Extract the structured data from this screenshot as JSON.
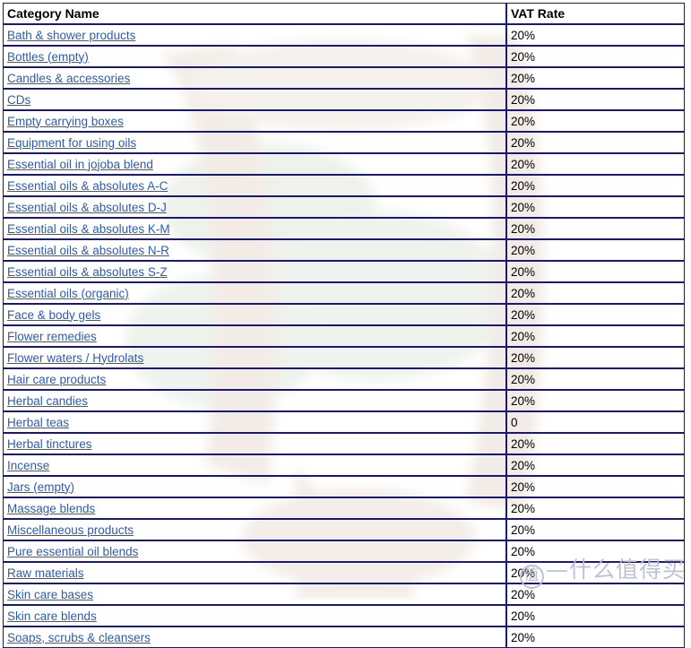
{
  "table": {
    "columns": [
      {
        "id": "category_name",
        "label": "Category Name"
      },
      {
        "id": "vat_rate",
        "label": "VAT Rate"
      }
    ],
    "rows": [
      {
        "category_name": "Bath & shower products",
        "vat_rate": "20%"
      },
      {
        "category_name": "Bottles (empty)",
        "vat_rate": "20%"
      },
      {
        "category_name": "Candles & accessories",
        "vat_rate": "20%"
      },
      {
        "category_name": "CDs",
        "vat_rate": "20%"
      },
      {
        "category_name": "Empty carrying boxes",
        "vat_rate": "20%"
      },
      {
        "category_name": "Equipment for using oils",
        "vat_rate": "20%"
      },
      {
        "category_name": "Essential oil in jojoba blend",
        "vat_rate": "20%"
      },
      {
        "category_name": "Essential oils & absolutes A-C",
        "vat_rate": "20%"
      },
      {
        "category_name": "Essential oils & absolutes D-J",
        "vat_rate": "20%"
      },
      {
        "category_name": "Essential oils & absolutes K-M",
        "vat_rate": "20%"
      },
      {
        "category_name": "Essential oils & absolutes N-R",
        "vat_rate": "20%"
      },
      {
        "category_name": "Essential oils & absolutes S-Z",
        "vat_rate": "20%"
      },
      {
        "category_name": "Essential oils (organic)",
        "vat_rate": "20%"
      },
      {
        "category_name": "Face & body gels",
        "vat_rate": "20%"
      },
      {
        "category_name": "Flower remedies",
        "vat_rate": "20%"
      },
      {
        "category_name": "Flower waters / Hydrolats",
        "vat_rate": "20%"
      },
      {
        "category_name": "Hair care products",
        "vat_rate": "20%"
      },
      {
        "category_name": "Herbal candies",
        "vat_rate": "20%"
      },
      {
        "category_name": "Herbal teas",
        "vat_rate": "0"
      },
      {
        "category_name": "Herbal tinctures",
        "vat_rate": "20%"
      },
      {
        "category_name": "Incense",
        "vat_rate": "20%"
      },
      {
        "category_name": "Jars (empty)",
        "vat_rate": "20%"
      },
      {
        "category_name": "Massage blends",
        "vat_rate": "20%"
      },
      {
        "category_name": "Miscellaneous products",
        "vat_rate": "20%"
      },
      {
        "category_name": "Pure essential oil blends",
        "vat_rate": "20%"
      },
      {
        "category_name": "Raw materials",
        "vat_rate": "20%"
      },
      {
        "category_name": "Skin care bases",
        "vat_rate": "20%"
      },
      {
        "category_name": "Skin care blends",
        "vat_rate": "20%"
      },
      {
        "category_name": "Soaps, scrubs & cleansers",
        "vat_rate": "20%"
      }
    ]
  },
  "watermark": {
    "logo_glyph": "值",
    "text": "—什么值得买"
  },
  "colors": {
    "border": "#191970",
    "link": "#2a5db0",
    "header_text": "#000000",
    "watermark": "#b9bcd2",
    "background": "#ffffff"
  }
}
